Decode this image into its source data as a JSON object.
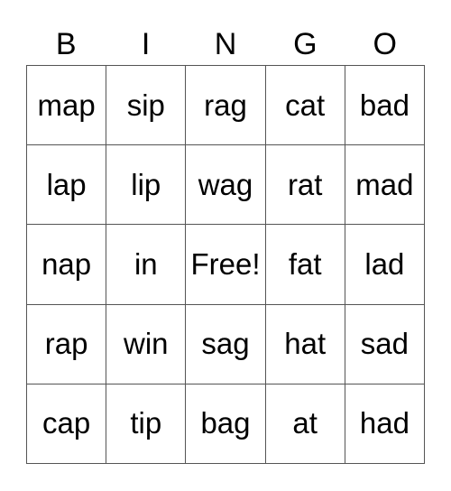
{
  "header": [
    "B",
    "I",
    "N",
    "G",
    "O"
  ],
  "rows": [
    [
      "map",
      "sip",
      "rag",
      "cat",
      "bad"
    ],
    [
      "lap",
      "lip",
      "wag",
      "rat",
      "mad"
    ],
    [
      "nap",
      "in",
      "Free!",
      "fat",
      "lad"
    ],
    [
      "rap",
      "win",
      "sag",
      "hat",
      "sad"
    ],
    [
      "cap",
      "tip",
      "bag",
      "at",
      "had"
    ]
  ]
}
